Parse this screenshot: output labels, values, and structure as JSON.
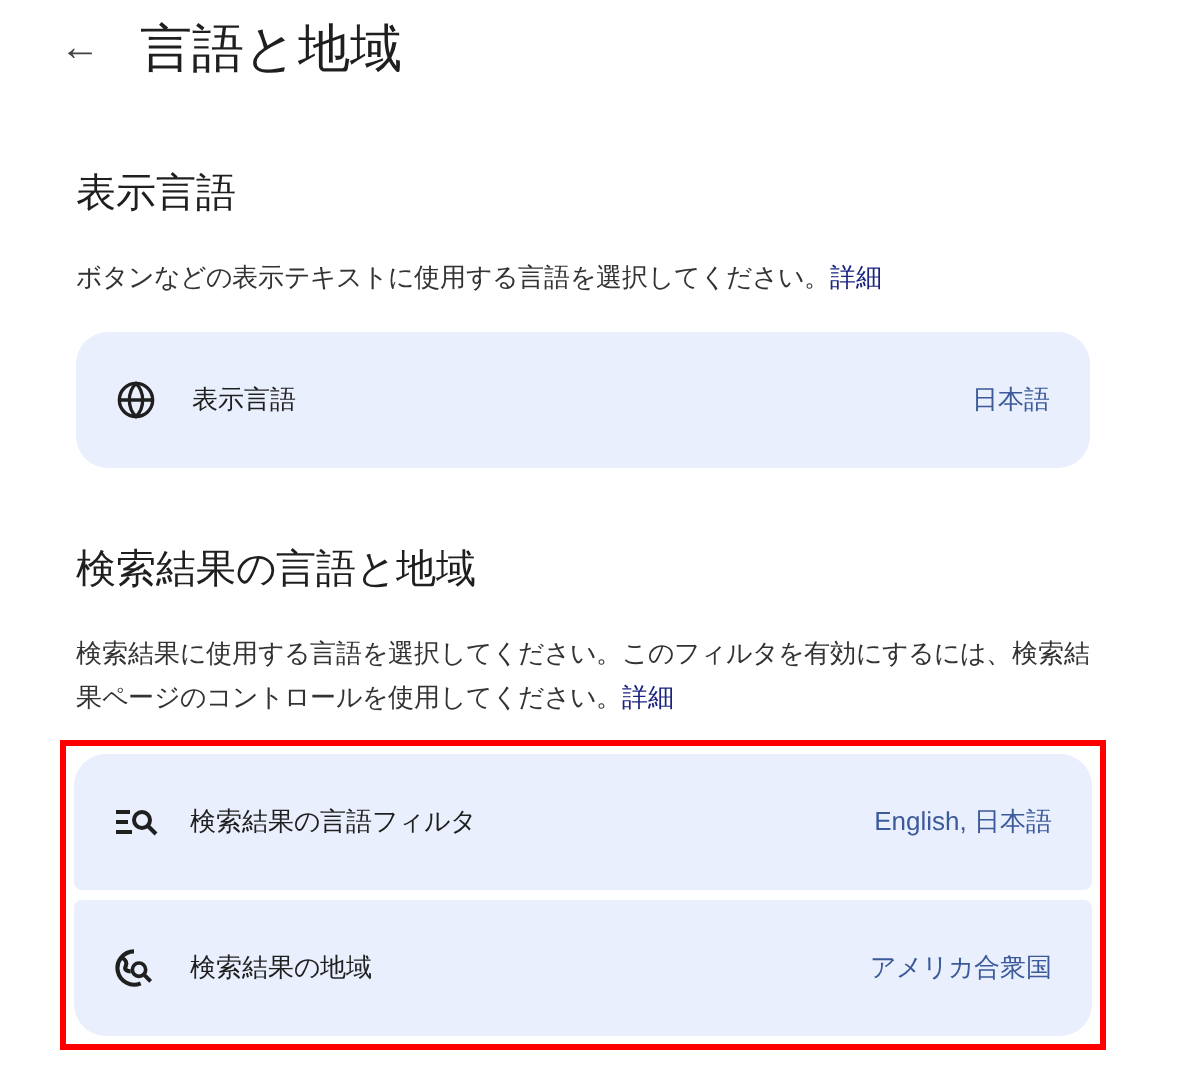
{
  "header": {
    "back": "←",
    "title": "言語と地域"
  },
  "sections": [
    {
      "heading": "表示言語",
      "description": "ボタンなどの表示テキストに使用する言語を選択してください。",
      "link": "詳細",
      "highlighted": false,
      "rows": [
        {
          "kind": "globe",
          "label": "表示言語",
          "value": "日本語"
        }
      ]
    },
    {
      "heading": "検索結果の言語と地域",
      "description": "検索結果に使用する言語を選択してください。このフィルタを有効にするには、検索結果ページのコントロールを使用してください。",
      "link": "詳細",
      "highlighted": true,
      "rows": [
        {
          "kind": "filter",
          "label": "検索結果の言語フィルタ",
          "value": "English, 日本語"
        },
        {
          "kind": "region",
          "label": "検索結果の地域",
          "value": "アメリカ合衆国"
        }
      ]
    }
  ]
}
